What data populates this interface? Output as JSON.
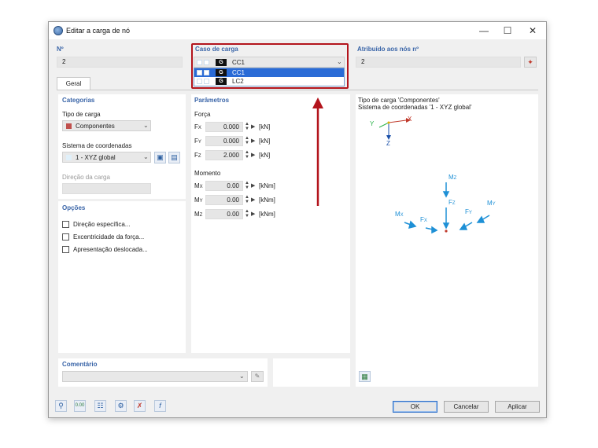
{
  "window": {
    "title": "Editar a carga de nó"
  },
  "header": {
    "no_label": "Nº",
    "no_value": "2",
    "loadcase_label": "Caso de carga",
    "loadcase_selected": {
      "tag": "G",
      "name": "CC1"
    },
    "loadcase_options": [
      {
        "tag": "G",
        "name": "CC1",
        "selected": true
      },
      {
        "tag": "G",
        "name": "LC2",
        "selected": false
      }
    ],
    "assigned_label": "Atribuído aos nós nº",
    "assigned_value": "2"
  },
  "tabs": [
    {
      "label": "Geral"
    }
  ],
  "left": {
    "categories_title": "Categorias",
    "load_type_label": "Tipo de carga",
    "load_type_value": "Componentes",
    "load_type_color": "#c0504d",
    "coord_label": "Sistema de coordenadas",
    "coord_value": "1 - XYZ global",
    "direction_label": "Direção da carga",
    "options_title": "Opções",
    "options": [
      {
        "label": "Direção específica...",
        "checked": false
      },
      {
        "label": "Excentricidade da força...",
        "checked": false
      },
      {
        "label": "Apresentação deslocada...",
        "checked": false
      }
    ]
  },
  "params": {
    "title": "Parâmetros",
    "force_label": "Força",
    "force": [
      {
        "sym": "F",
        "sub": "X",
        "value": "0.000",
        "unit": "[kN]"
      },
      {
        "sym": "F",
        "sub": "Y",
        "value": "0.000",
        "unit": "[kN]"
      },
      {
        "sym": "F",
        "sub": "Z",
        "value": "2.000",
        "unit": "[kN]"
      }
    ],
    "moment_label": "Momento",
    "moment": [
      {
        "sym": "M",
        "sub": "X",
        "value": "0.00",
        "unit": "[kNm]"
      },
      {
        "sym": "M",
        "sub": "Y",
        "value": "0.00",
        "unit": "[kNm]"
      },
      {
        "sym": "M",
        "sub": "Z",
        "value": "0.00",
        "unit": "[kNm]"
      }
    ]
  },
  "preview": {
    "line1": "Tipo de carga 'Componentes'",
    "line2": "Sistema de coordenadas '1 - XYZ global'",
    "axes": {
      "x": "X",
      "y": "Y",
      "z": "Z"
    },
    "labels": {
      "mz": "M",
      "mz_sub": "Z",
      "fz": "F",
      "fz_sub": "Z",
      "mx": "M",
      "mx_sub": "X",
      "fx": "F",
      "fx_sub": "X",
      "fy": "F",
      "fy_sub": "Y",
      "my": "M",
      "my_sub": "Y"
    }
  },
  "comment": {
    "label": "Comentário",
    "value": ""
  },
  "buttons": {
    "ok": "OK",
    "cancel": "Cancelar",
    "apply": "Aplicar"
  },
  "colors": {
    "accent": "#3a65a8",
    "highlight_row": "#2a6bd6",
    "annotation": "#b3141c",
    "load_arrow": "#1e90d6"
  }
}
